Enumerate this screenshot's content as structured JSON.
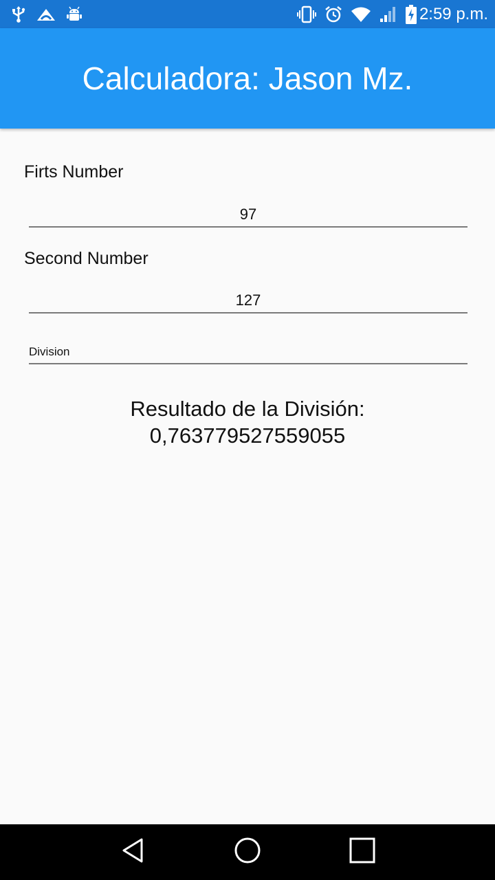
{
  "status_bar": {
    "time": "2:59 p.m.",
    "left_icons": [
      "usb-icon",
      "cloud-sync-icon",
      "android-debug-icon"
    ],
    "right_icons": [
      "vibrate-icon",
      "alarm-icon",
      "wifi-icon",
      "signal-icon",
      "battery-charging-icon"
    ]
  },
  "app_bar": {
    "title": "Calculadora: Jason Mz.",
    "color": "#2196f3",
    "status_color": "#1976d2"
  },
  "form": {
    "first_label": "Firts Number",
    "first_value": "97",
    "second_label": "Second Number",
    "second_value": "127",
    "operation_selected": "Division"
  },
  "result": {
    "line1": "Resultado de la División:",
    "line2": "0,763779527559055"
  },
  "nav_bar": {
    "buttons": [
      "back-icon",
      "home-icon",
      "recents-icon"
    ]
  }
}
